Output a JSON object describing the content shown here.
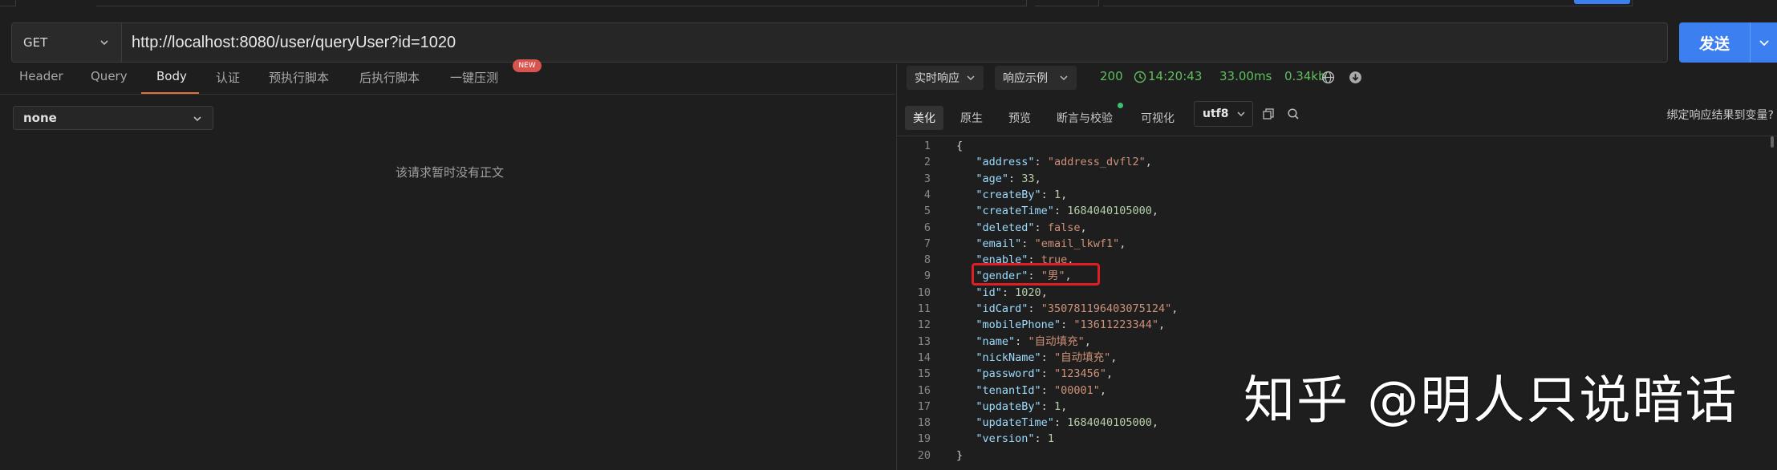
{
  "request": {
    "method": "GET",
    "url": "http://localhost:8080/user/queryUser?id=1020",
    "send_label": "发送"
  },
  "request_tabs": [
    {
      "label": "Header"
    },
    {
      "label": "Query"
    },
    {
      "label": "Body"
    },
    {
      "label": "认证"
    },
    {
      "label": "预执行脚本"
    },
    {
      "label": "后执行脚本"
    },
    {
      "label": "一键压测"
    }
  ],
  "active_request_tab": "Body",
  "new_badge": "NEW",
  "body": {
    "type_value": "none",
    "empty_text": "该请求暂时没有正文"
  },
  "response": {
    "mode_label": "实时响应",
    "example_label": "响应示例",
    "status": "200",
    "time": "14:20:43",
    "duration": "33.00ms",
    "size": "0.34kb",
    "view_tabs": [
      {
        "label": "美化"
      },
      {
        "label": "原生"
      },
      {
        "label": "预览"
      },
      {
        "label": "断言与校验"
      },
      {
        "label": "可视化"
      }
    ],
    "encoding": "utf8",
    "bind_label": "绑定响应结果到变量?"
  },
  "json_lines": [
    {
      "n": "1",
      "text": "{"
    },
    {
      "n": "2",
      "key": "\"address\"",
      "val": "\"address_dvfl2\"",
      "t": "str"
    },
    {
      "n": "3",
      "key": "\"age\"",
      "val": "33",
      "t": "num"
    },
    {
      "n": "4",
      "key": "\"createBy\"",
      "val": "1",
      "t": "num"
    },
    {
      "n": "5",
      "key": "\"createTime\"",
      "val": "1684040105000",
      "t": "num"
    },
    {
      "n": "6",
      "key": "\"deleted\"",
      "val": "false",
      "t": "lit"
    },
    {
      "n": "7",
      "key": "\"email\"",
      "val": "\"email_lkwf1\"",
      "t": "str"
    },
    {
      "n": "8",
      "key": "\"enable\"",
      "val": "true",
      "t": "lit"
    },
    {
      "n": "9",
      "key": "\"gender\"",
      "val": "\"男\"",
      "t": "str"
    },
    {
      "n": "10",
      "key": "\"id\"",
      "val": "1020",
      "t": "num"
    },
    {
      "n": "11",
      "key": "\"idCard\"",
      "val": "\"350781196403075124\"",
      "t": "str"
    },
    {
      "n": "12",
      "key": "\"mobilePhone\"",
      "val": "\"13611223344\"",
      "t": "str"
    },
    {
      "n": "13",
      "key": "\"name\"",
      "val": "\"自动填充\"",
      "t": "str"
    },
    {
      "n": "14",
      "key": "\"nickName\"",
      "val": "\"自动填充\"",
      "t": "str"
    },
    {
      "n": "15",
      "key": "\"password\"",
      "val": "\"123456\"",
      "t": "str"
    },
    {
      "n": "16",
      "key": "\"tenantId\"",
      "val": "\"00001\"",
      "t": "str"
    },
    {
      "n": "17",
      "key": "\"updateBy\"",
      "val": "1",
      "t": "num"
    },
    {
      "n": "18",
      "key": "\"updateTime\"",
      "val": "1684040105000",
      "t": "num"
    },
    {
      "n": "19",
      "key": "\"version\"",
      "val": "1",
      "t": "num",
      "last": true
    },
    {
      "n": "20",
      "text": "}"
    }
  ],
  "watermark": "知乎 @明人只说暗话",
  "colors": {
    "accent": "#3b7ff0",
    "tab_underline": "#e2703a",
    "status_ok": "#5fbf5f",
    "highlight": "#e01d24"
  },
  "icons": [
    "chevron-down-icon",
    "clock-icon",
    "globe-icon",
    "download-icon",
    "copy-icon",
    "search-icon"
  ]
}
